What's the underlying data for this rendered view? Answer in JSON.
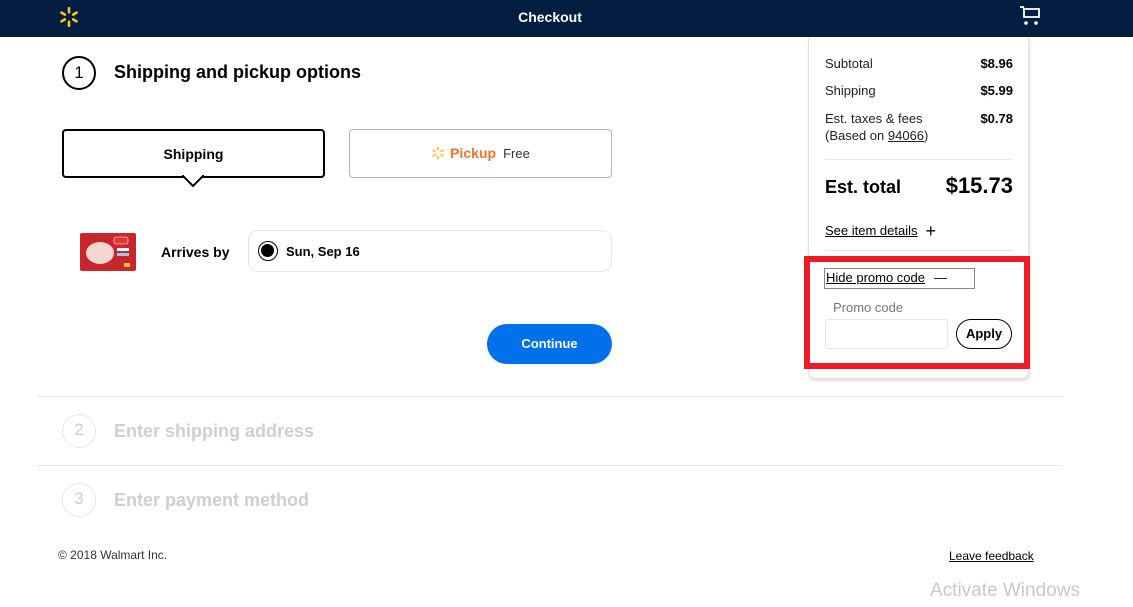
{
  "header": {
    "title": "Checkout",
    "logo_icon": "walmart-spark-icon",
    "cart_icon": "cart-icon"
  },
  "colors": {
    "header_bg": "#041e42",
    "spark_yellow": "#ffc220",
    "pickup_orange": "#f47321",
    "primary_blue": "#0071eb",
    "highlight_red": "#ed1c24"
  },
  "steps": [
    {
      "number": "1",
      "title": "Shipping and pickup options",
      "active": true
    },
    {
      "number": "2",
      "title": "Enter shipping address",
      "active": false
    },
    {
      "number": "3",
      "title": "Enter payment method",
      "active": false
    }
  ],
  "fulfillment": {
    "shipping_label": "Shipping",
    "pickup_label": "Pickup",
    "pickup_price": "Free",
    "selected": "Shipping"
  },
  "delivery": {
    "arrives_label": "Arrives by",
    "date_option": "Sun, Sep 16",
    "product_image_alt": "Huggies diapers pack"
  },
  "continue_label": "Continue",
  "summary": {
    "subtotal_label": "Subtotal",
    "subtotal_value": "$8.96",
    "shipping_label": "Shipping",
    "shipping_value": "$5.99",
    "taxes_label": "Est. taxes & fees",
    "taxes_based_prefix": "(Based on ",
    "taxes_zip": "94066",
    "taxes_based_suffix": ")",
    "taxes_value": "$0.78",
    "total_label": "Est. total",
    "total_value": "$15.73",
    "see_details_label": "See item details",
    "see_details_icon": "+",
    "hide_promo_label": "Hide promo code",
    "hide_promo_icon": "—",
    "promo_label": "Promo code",
    "promo_value": "",
    "promo_placeholder": "",
    "apply_label": "Apply"
  },
  "footer": {
    "copyright": "© 2018 Walmart Inc.",
    "feedback": "Leave feedback"
  },
  "watermark": "Activate Windows"
}
